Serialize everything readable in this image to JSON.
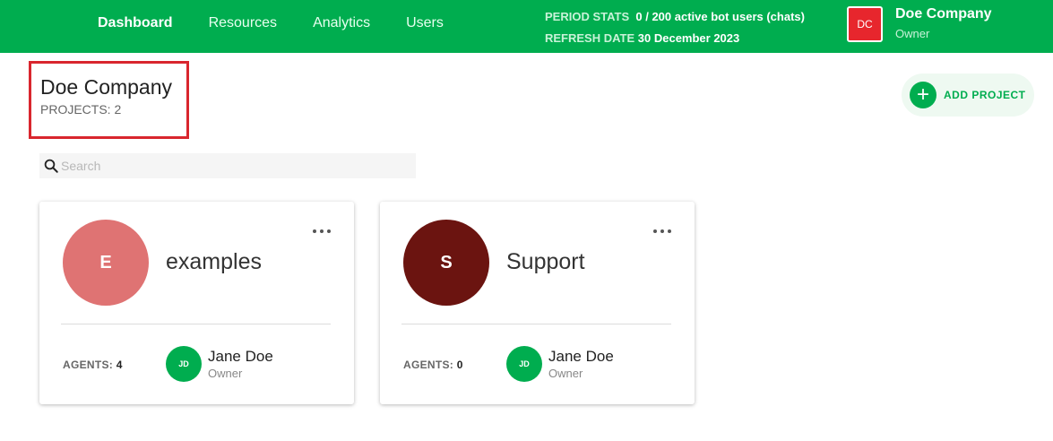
{
  "nav": {
    "items": [
      "Dashboard",
      "Resources",
      "Analytics",
      "Users"
    ],
    "active": "Dashboard"
  },
  "stats": {
    "period_label": "PERIOD STATS",
    "period_value": "0  / 200 active bot users (chats)",
    "refresh_label": "REFRESH DATE",
    "refresh_value": "30 December 2023"
  },
  "account": {
    "initials": "DC",
    "name": "Doe Company",
    "role": "Owner"
  },
  "header": {
    "company": "Doe Company",
    "projects_count": "PROJECTS: 2",
    "add_project_label": "ADD PROJECT"
  },
  "search": {
    "placeholder": "Search"
  },
  "projects": [
    {
      "initial": "E",
      "name": "examples",
      "avatar_color": "#df7373",
      "agents_label": "AGENTS:",
      "agents_count": "4",
      "owner_initials": "JD",
      "owner_name": "Jane Doe",
      "owner_role": "Owner"
    },
    {
      "initial": "S",
      "name": "Support",
      "avatar_color": "#6b1410",
      "agents_label": "AGENTS:",
      "agents_count": "0",
      "owner_initials": "JD",
      "owner_name": "Jane Doe",
      "owner_role": "Owner"
    }
  ],
  "colors": {
    "brand": "#00ad4f",
    "highlight_border": "#d9262e",
    "account_avatar": "#e7262d"
  }
}
